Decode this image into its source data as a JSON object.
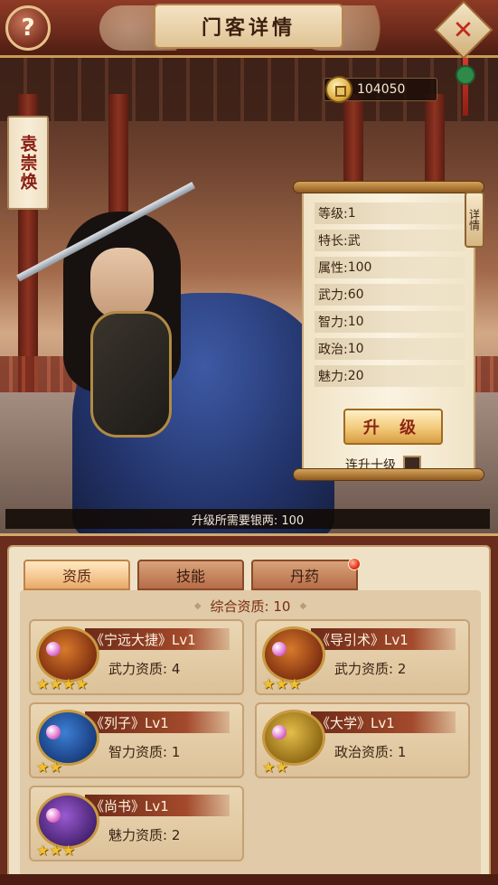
{
  "header": {
    "title": "门客详情",
    "help_label": "?",
    "close_label": "✕"
  },
  "hero": {
    "name": "袁崇焕"
  },
  "currency": {
    "icon": "coin-icon",
    "amount": "104050"
  },
  "stats_panel": {
    "detail_tab": "详情",
    "rows": [
      {
        "label": "等级:",
        "value": "1"
      },
      {
        "label": "特长:",
        "value": "武"
      },
      {
        "label": "属性:",
        "value": "100"
      },
      {
        "label": "武力:",
        "value": "60"
      },
      {
        "label": "智力:",
        "value": "10"
      },
      {
        "label": "政治:",
        "value": "10"
      },
      {
        "label": "魅力:",
        "value": "20"
      }
    ],
    "upgrade_label": "升 级",
    "auto_upgrade_label": "连升十级"
  },
  "cost_bar": {
    "text": "升级所需要银两: 100"
  },
  "tabs": [
    {
      "label": "资质",
      "active": true
    },
    {
      "label": "技能",
      "active": false
    },
    {
      "label": "丹药",
      "active": false,
      "badge": true
    }
  ],
  "summary": {
    "text": "综合资质: 10"
  },
  "cards": [
    {
      "name": "《宁远大捷》Lv1",
      "quality": "武力资质:  4",
      "stars": 4,
      "color": "orange"
    },
    {
      "name": "《导引术》Lv1",
      "quality": "武力资质:  2",
      "stars": 3,
      "color": "orange"
    },
    {
      "name": "《列子》Lv1",
      "quality": "智力资质:  1",
      "stars": 2,
      "color": "blue"
    },
    {
      "name": "《大学》Lv1",
      "quality": "政治资质:  1",
      "stars": 2,
      "color": "gold"
    },
    {
      "name": "《尚书》Lv1",
      "quality": "魅力资质:  2",
      "stars": 3,
      "color": "purple"
    }
  ]
}
